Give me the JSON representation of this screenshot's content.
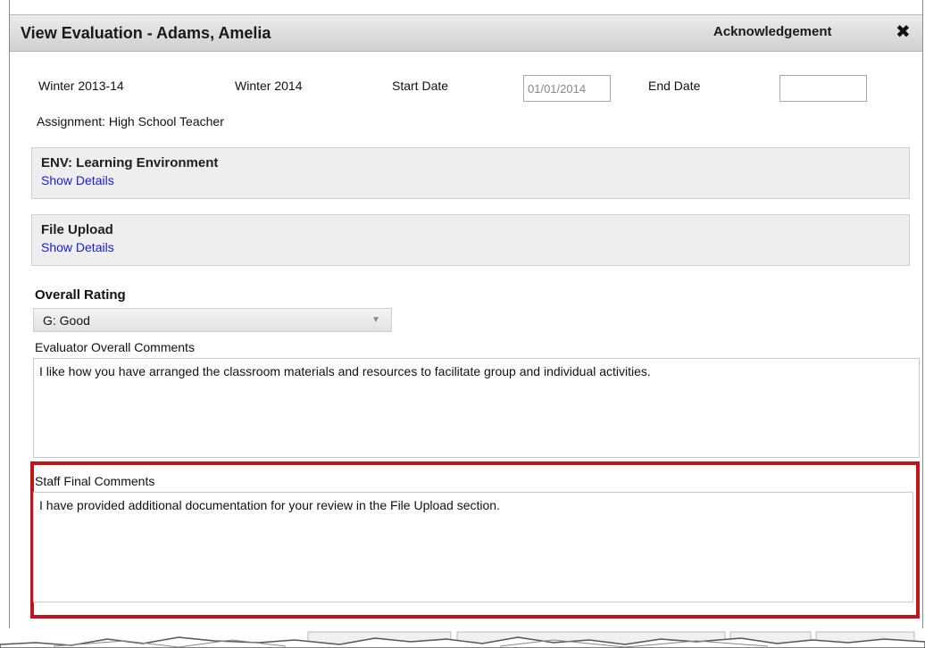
{
  "dialog": {
    "title": "View Evaluation - Adams, Amelia",
    "acknowledgement_label": "Acknowledgement",
    "close_glyph": "✖"
  },
  "header": {
    "term": "Winter 2013-14",
    "period": "Winter 2014",
    "start_date_label": "Start Date",
    "start_date_value": "01/01/2014",
    "end_date_label": "End Date",
    "end_date_value": "",
    "assignment": "Assignment: High School Teacher"
  },
  "sections": [
    {
      "title": "ENV: Learning Environment",
      "link": "Show Details"
    },
    {
      "title": "File Upload",
      "link": "Show Details"
    }
  ],
  "overall_rating": {
    "label": "Overall Rating",
    "selected": "G: Good"
  },
  "evaluator_comments": {
    "label": "Evaluator Overall Comments",
    "text": "I like how you have arranged the classroom materials and resources to facilitate group and individual activities."
  },
  "staff_comments": {
    "label": "Staff Final Comments",
    "text": "I have provided additional documentation for your review in the File Upload section."
  },
  "colors": {
    "highlight": "#c0141a",
    "link": "#1a1ad8"
  }
}
